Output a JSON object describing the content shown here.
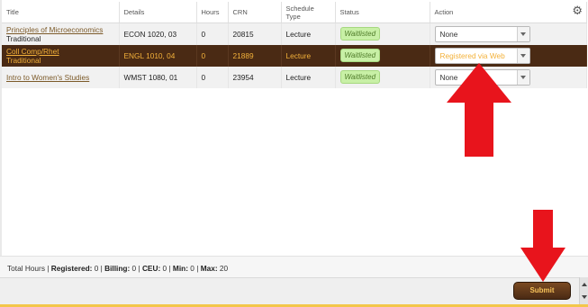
{
  "table": {
    "headers": [
      "Title",
      "Details",
      "Hours",
      "CRN",
      "Schedule Type",
      "Status",
      "Action"
    ],
    "rows": [
      {
        "title": "Principles of Microeconomics",
        "subtitle": "Traditional",
        "details": "ECON 1020, 03",
        "hours": "0",
        "crn": "20815",
        "schedule_type": "Lecture",
        "status": "Waitlisted",
        "action": "None"
      },
      {
        "title": "Coll Comp/Rhet",
        "subtitle": "Traditional",
        "details": "ENGL 1010, 04",
        "hours": "0",
        "crn": "21889",
        "schedule_type": "Lecture",
        "status": "Waitlisted",
        "action": "Registered via Web"
      },
      {
        "title": "Intro to Women's Studies",
        "subtitle": "",
        "details": "WMST 1080, 01",
        "hours": "0",
        "crn": "23954",
        "schedule_type": "Lecture",
        "status": "Waitlisted",
        "action": "None"
      }
    ]
  },
  "totals": {
    "label": "Total Hours |",
    "registered_label": "Registered:",
    "registered": "0",
    "billing_label": "Billing:",
    "billing": "0",
    "ceu_label": "CEU:",
    "ceu": "0",
    "min_label": "Min:",
    "min": "0",
    "max_label": "Max:",
    "max": "20"
  },
  "footer": {
    "submit_label": "Submit"
  },
  "colors": {
    "brand_dark": "#4a2a14",
    "accent_gold": "#f3b13a",
    "waitlist_bg": "#c8f0a6",
    "annotation_red": "#e8141c"
  },
  "icons": {
    "settings": "gear-icon"
  }
}
